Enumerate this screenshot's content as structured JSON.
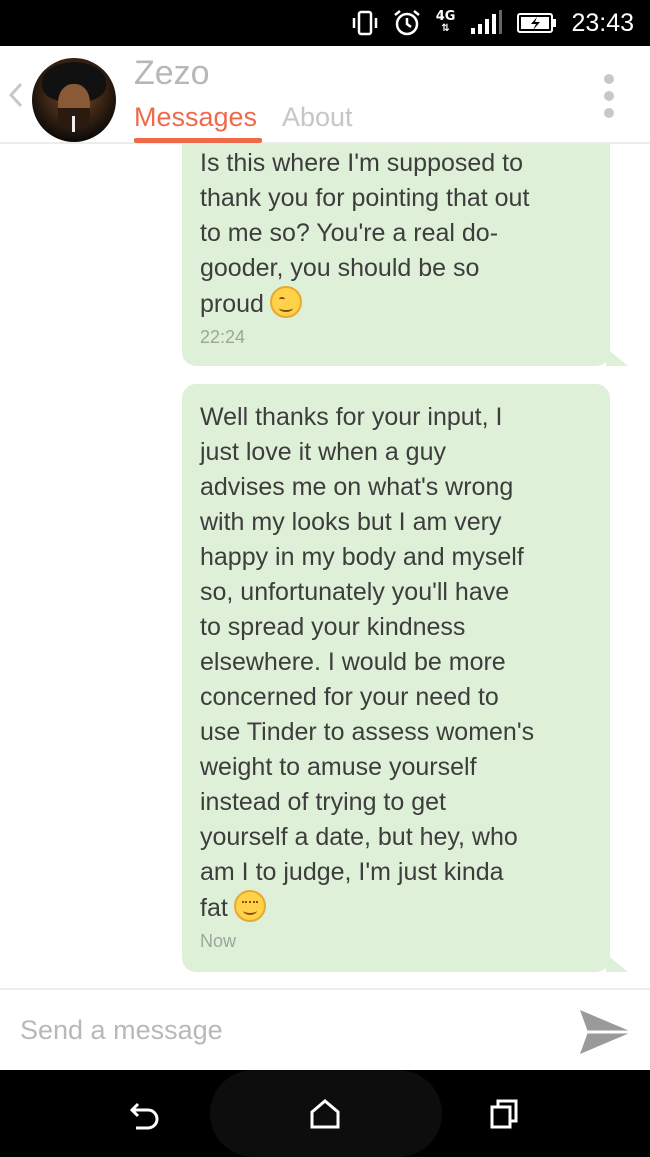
{
  "status_bar": {
    "network": "4G",
    "time": "23:43",
    "icons": [
      "vibrate-icon",
      "alarm-icon",
      "signal-icon",
      "battery-charging-icon"
    ]
  },
  "header": {
    "contact_name": "Zezo",
    "tabs": [
      {
        "label": "Messages",
        "active": true
      },
      {
        "label": "About",
        "active": false
      }
    ],
    "accent_color": "#f06a4a"
  },
  "messages": [
    {
      "lines": [
        "Is this where I'm supposed to",
        "thank you for pointing that out",
        "to me so? You're a real do-",
        "gooder, you should be so",
        "proud"
      ],
      "emoji": "winking-face-emoji",
      "time": "22:24"
    },
    {
      "lines": [
        "Well thanks for your input,  I",
        "just love it when a guy",
        "advises me on what's wrong",
        "with my looks but I am very",
        "happy in my body and myself",
        "so, unfortunately you'll have",
        "to spread your kindness",
        "elsewhere. I would be more",
        "concerned for your need to",
        "use Tinder to assess women's",
        "weight to amuse yourself",
        "instead of trying to get",
        "yourself a date, but hey, who",
        "am I to judge, I'm just kinda",
        "fat"
      ],
      "emoji": "smiling-face-emoji",
      "time": "Now"
    }
  ],
  "composer": {
    "placeholder": "Send a message",
    "value": ""
  },
  "colors": {
    "bubble": "#dff0d8",
    "bubble_text": "#3d3d3d"
  }
}
